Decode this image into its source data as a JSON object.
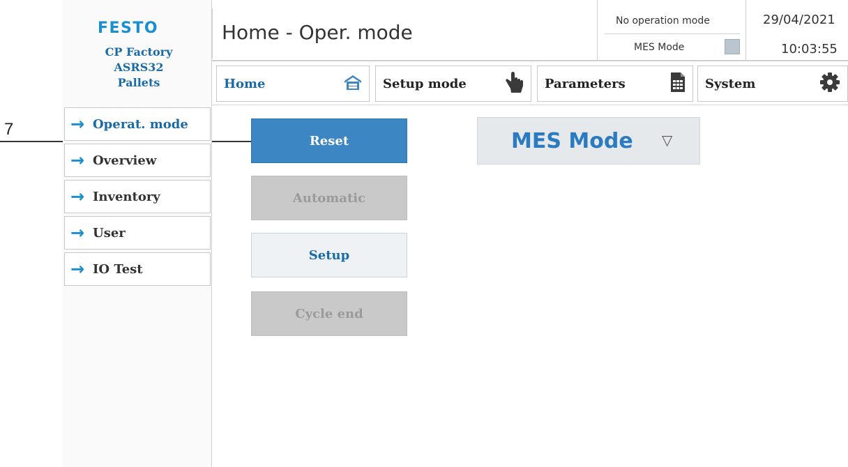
{
  "callout": {
    "number": "7"
  },
  "brand": {
    "logo": "FESTO"
  },
  "station": {
    "line1": "CP Factory",
    "line2": "ASRS32",
    "line3": "Pallets"
  },
  "nav": {
    "items": [
      {
        "label": "Operat. mode",
        "active": true
      },
      {
        "label": "Overview",
        "active": false
      },
      {
        "label": "Inventory",
        "active": false
      },
      {
        "label": "User",
        "active": false
      },
      {
        "label": "IO Test",
        "active": false
      }
    ]
  },
  "header": {
    "title": "Home - Oper. mode",
    "status": "No operation mode",
    "mes_label": "MES Mode",
    "date": "29/04/2021",
    "time": "10:03:55"
  },
  "tabs": [
    {
      "label": "Home",
      "icon": "home-icon"
    },
    {
      "label": "Setup mode",
      "icon": "hand-pointer-icon"
    },
    {
      "label": "Parameters",
      "icon": "spreadsheet-icon"
    },
    {
      "label": "System",
      "icon": "gear-icon"
    }
  ],
  "buttons": {
    "reset": "Reset",
    "automatic": "Automatic",
    "setup": "Setup",
    "cycle_end": "Cycle end"
  },
  "mode_select": {
    "value": "MES Mode"
  },
  "colors": {
    "accent": "#1a8fd0",
    "primary_button": "#3d86c4",
    "disabled_button": "#c9c9c9",
    "text_blue": "#1a6aa6"
  }
}
